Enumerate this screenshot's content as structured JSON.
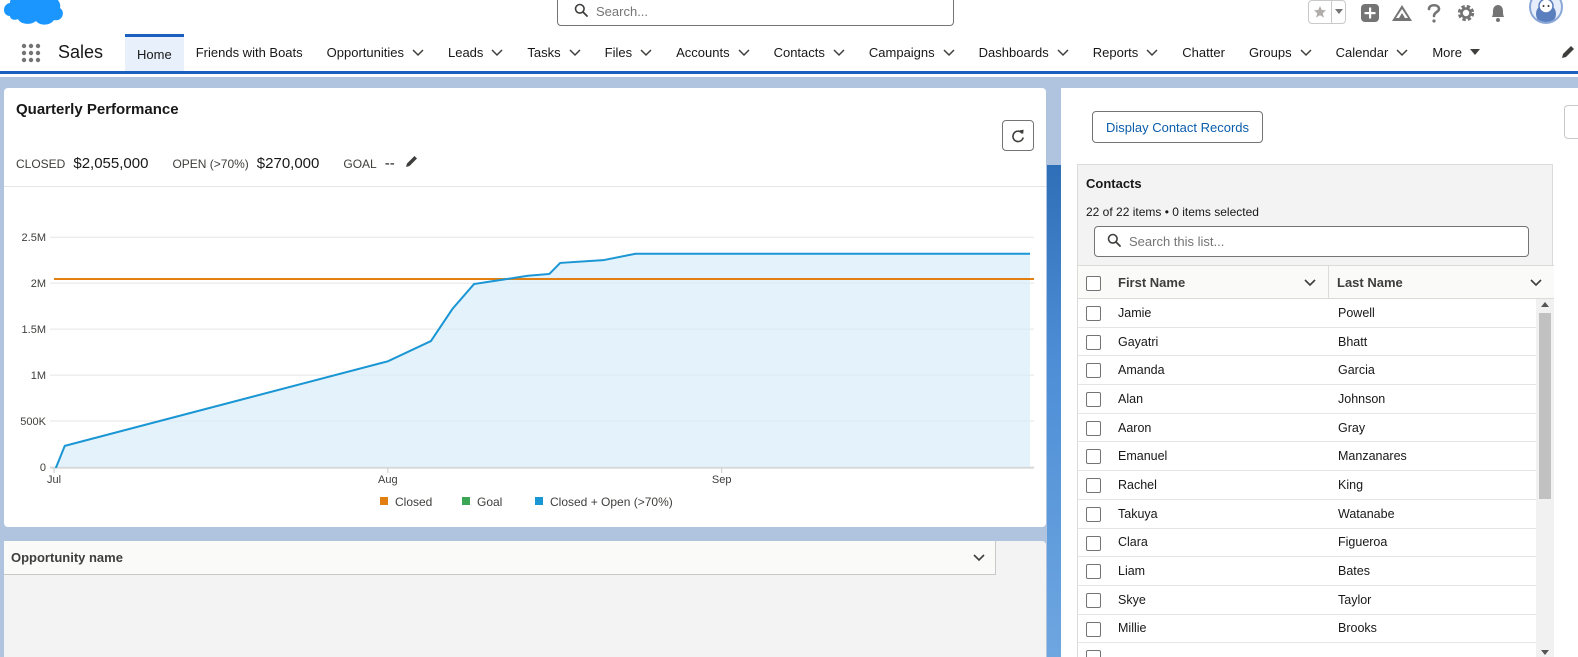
{
  "header": {
    "search_placeholder": "Search...",
    "icons": [
      "salesforce-cloud-icon",
      "search-icon",
      "star-icon",
      "chevron-down-icon",
      "plus-icon",
      "trailhead-icon",
      "help-icon",
      "gear-icon",
      "bell-icon",
      "avatar"
    ]
  },
  "nav": {
    "app_name": "Sales",
    "items": [
      {
        "label": "Home",
        "active": true,
        "chevron": false
      },
      {
        "label": "Friends with Boats",
        "chevron": false
      },
      {
        "label": "Opportunities",
        "chevron": true
      },
      {
        "label": "Leads",
        "chevron": true
      },
      {
        "label": "Tasks",
        "chevron": true
      },
      {
        "label": "Files",
        "chevron": true
      },
      {
        "label": "Accounts",
        "chevron": true
      },
      {
        "label": "Contacts",
        "chevron": true
      },
      {
        "label": "Campaigns",
        "chevron": true
      },
      {
        "label": "Dashboards",
        "chevron": true
      },
      {
        "label": "Reports",
        "chevron": true
      },
      {
        "label": "Chatter",
        "chevron": false
      },
      {
        "label": "Groups",
        "chevron": true
      },
      {
        "label": "Calendar",
        "chevron": true
      },
      {
        "label": "More",
        "chevron": true
      }
    ]
  },
  "quarterly": {
    "title": "Quarterly Performance",
    "closed_label": "CLOSED",
    "closed_value": "$2,055,000",
    "open_label": "OPEN (>70%)",
    "open_value": "$270,000",
    "goal_label": "GOAL",
    "goal_value": "--"
  },
  "chart_data": {
    "type": "line",
    "title": "",
    "xlabel": "",
    "ylabel": "",
    "x_ticks": [
      "Jul",
      "Aug",
      "Sep"
    ],
    "x_range": [
      "Jul 1",
      "Sep 30"
    ],
    "y_ticks": [
      "0",
      "500K",
      "1M",
      "1.5M",
      "2M",
      "2.5M"
    ],
    "ylim": [
      0,
      2600000
    ],
    "grid": true,
    "legend_position": "bottom",
    "series": [
      {
        "name": "Closed",
        "color": "#e37f10",
        "type": "line",
        "points": [
          [
            0,
            2045000
          ],
          [
            91,
            2045000
          ]
        ]
      },
      {
        "name": "Goal",
        "color": "#3ba755",
        "type": "line",
        "points": []
      },
      {
        "name": "Closed + Open (>70%)",
        "color": "#1b96d4",
        "type": "area",
        "points": [
          [
            0,
            -60000
          ],
          [
            1,
            230000
          ],
          [
            31,
            1150000
          ],
          [
            35,
            1370000
          ],
          [
            37,
            1720000
          ],
          [
            39,
            1990000
          ],
          [
            44,
            2080000
          ],
          [
            46,
            2100000
          ],
          [
            47,
            2220000
          ],
          [
            51,
            2250000
          ],
          [
            54,
            2320000
          ],
          [
            91,
            2320000
          ]
        ]
      }
    ]
  },
  "opportunity": {
    "column_label": "Opportunity name"
  },
  "contacts": {
    "display_button": "Display Contact Records",
    "title": "Contacts",
    "count_text": "22 of 22 items • 0 items selected",
    "search_placeholder": "Search this list...",
    "columns": [
      "First Name",
      "Last Name"
    ],
    "rows": [
      {
        "first": "Jamie",
        "last": "Powell"
      },
      {
        "first": "Gayatri",
        "last": "Bhatt"
      },
      {
        "first": "Amanda",
        "last": "Garcia"
      },
      {
        "first": "Alan",
        "last": "Johnson"
      },
      {
        "first": "Aaron",
        "last": "Gray"
      },
      {
        "first": "Emanuel",
        "last": "Manzanares"
      },
      {
        "first": "Rachel",
        "last": "King"
      },
      {
        "first": "Takuya",
        "last": "Watanabe"
      },
      {
        "first": "Clara",
        "last": "Figueroa"
      },
      {
        "first": "Liam",
        "last": "Bates"
      },
      {
        "first": "Skye",
        "last": "Taylor"
      },
      {
        "first": "Millie",
        "last": "Brooks"
      }
    ]
  }
}
